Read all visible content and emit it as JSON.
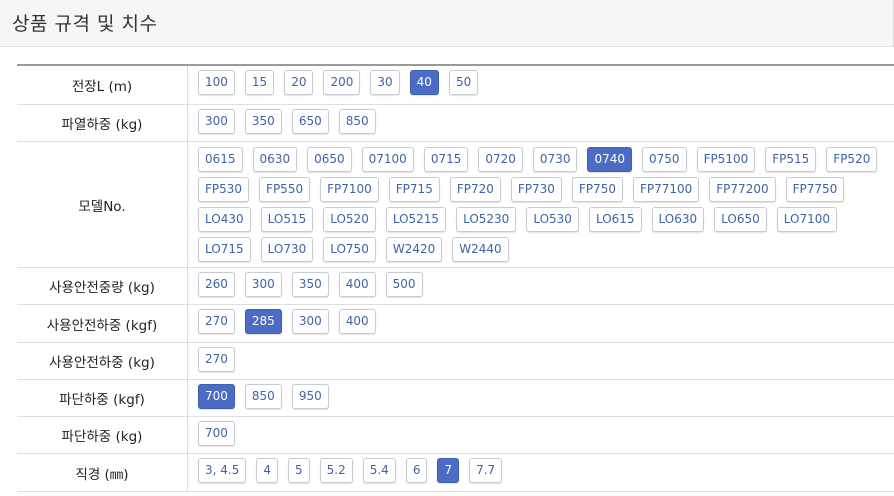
{
  "header": {
    "title": "상품 규격 및 치수"
  },
  "rows": [
    {
      "label": "전장L (m)",
      "selected": "40",
      "options": [
        "100",
        "15",
        "20",
        "200",
        "30",
        "40",
        "50"
      ]
    },
    {
      "label": "파열하중 (kg)",
      "selected": "",
      "options": [
        "300",
        "350",
        "650",
        "850"
      ]
    },
    {
      "label": "모델No.",
      "selected": "0740",
      "options": [
        "0615",
        "0630",
        "0650",
        "07100",
        "0715",
        "0720",
        "0730",
        "0740",
        "0750",
        "FP5100",
        "FP515",
        "FP520",
        "FP530",
        "FP550",
        "FP7100",
        "FP715",
        "FP720",
        "FP730",
        "FP750",
        "FP77100",
        "FP77200",
        "FP7750",
        "LO430",
        "LO515",
        "LO520",
        "LO5215",
        "LO5230",
        "LO530",
        "LO615",
        "LO630",
        "LO650",
        "LO7100",
        "LO715",
        "LO730",
        "LO750",
        "W2420",
        "W2440"
      ]
    },
    {
      "label": "사용안전중량 (kg)",
      "selected": "",
      "options": [
        "260",
        "300",
        "350",
        "400",
        "500"
      ]
    },
    {
      "label": "사용안전하중 (kgf)",
      "selected": "285",
      "options": [
        "270",
        "285",
        "300",
        "400"
      ]
    },
    {
      "label": "사용안전하중 (kg)",
      "selected": "",
      "options": [
        "270"
      ]
    },
    {
      "label": "파단하중 (kgf)",
      "selected": "700",
      "options": [
        "700",
        "850",
        "950"
      ]
    },
    {
      "label": "파단하중 (kg)",
      "selected": "",
      "options": [
        "700"
      ]
    },
    {
      "label": "직경 (㎜)",
      "selected": "7",
      "options": [
        "3, 4.5",
        "4",
        "5",
        "5.2",
        "5.4",
        "6",
        "7",
        "7.7"
      ]
    }
  ],
  "colors": {
    "accent": "#4b6cc2",
    "option_text": "#3e64a8",
    "header_bg": "#f6f6f6"
  }
}
